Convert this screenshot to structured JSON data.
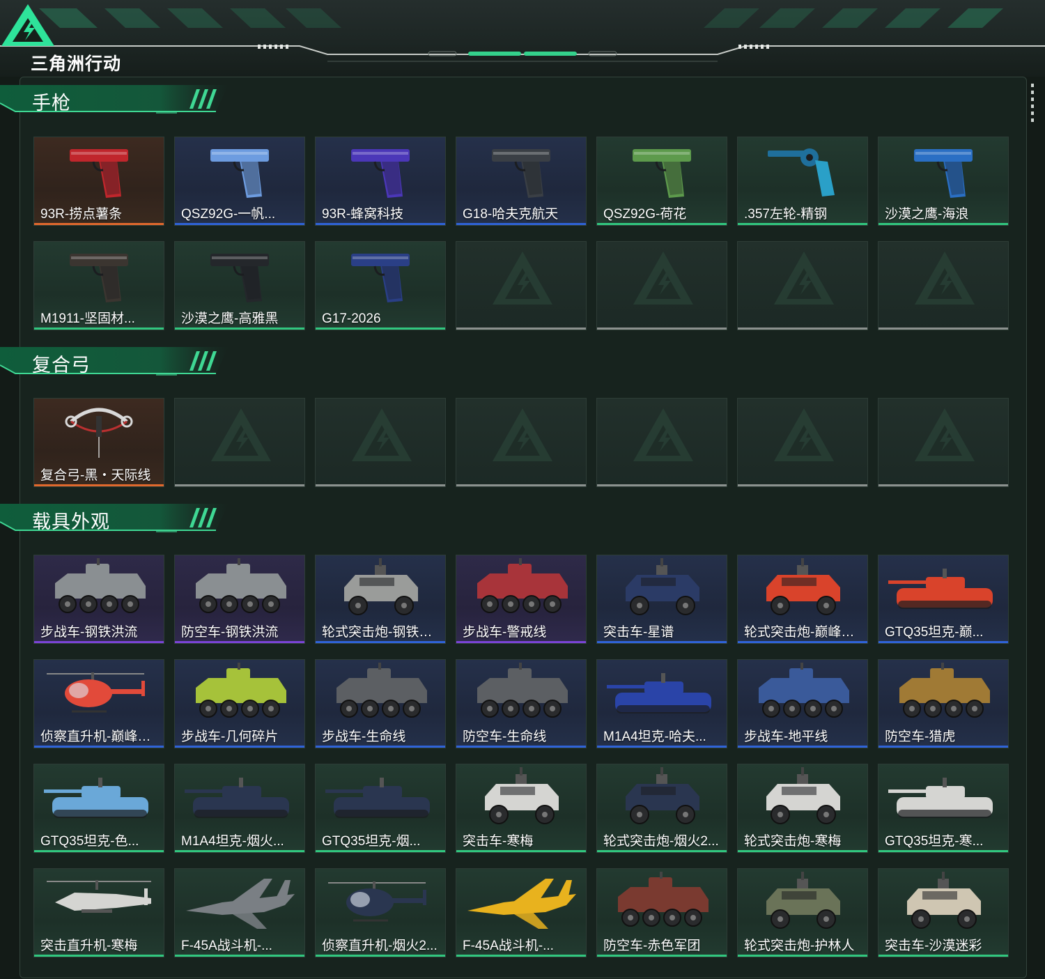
{
  "app": {
    "logo_text": "三角洲行动"
  },
  "colors": {
    "accent": "#31c77f",
    "rarity_orange": "#e1692d",
    "rarity_purple": "#7a44d6",
    "rarity_blue": "#2f63d8",
    "rarity_green": "#31c77f"
  },
  "sections": [
    {
      "title": "手枪",
      "items": [
        {
          "name": "93R-捞点薯条",
          "rarity": "orange",
          "icon": "pistol-icon",
          "color": "#c0262c"
        },
        {
          "name": "QSZ92G-一帆...",
          "rarity": "blue",
          "icon": "pistol-icon",
          "color": "#6d9ce0"
        },
        {
          "name": "93R-蜂窝科技",
          "rarity": "blue",
          "icon": "pistol-icon",
          "color": "#4b37b8"
        },
        {
          "name": "G18-哈夫克航天",
          "rarity": "blue",
          "icon": "pistol-icon",
          "color": "#3a3f45"
        },
        {
          "name": "QSZ92G-荷花",
          "rarity": "green",
          "icon": "pistol-icon",
          "color": "#5d9a4c"
        },
        {
          "name": ".357左轮-精钢",
          "rarity": "green",
          "icon": "revolver-icon",
          "color": "#1f6f9c"
        },
        {
          "name": "沙漠之鹰-海浪",
          "rarity": "green",
          "icon": "pistol-icon",
          "color": "#2a6fc4"
        },
        {
          "name": "M1911-坚固材...",
          "rarity": "green",
          "icon": "pistol-icon",
          "color": "#3b3530"
        },
        {
          "name": "沙漠之鹰-高雅黑",
          "rarity": "green",
          "icon": "pistol-icon",
          "color": "#24272b"
        },
        {
          "name": "G17-2026",
          "rarity": "green",
          "icon": "pistol-icon",
          "color": "#2a3f86"
        },
        {
          "name": "",
          "rarity": "empty"
        },
        {
          "name": "",
          "rarity": "empty"
        },
        {
          "name": "",
          "rarity": "empty"
        },
        {
          "name": "",
          "rarity": "empty"
        }
      ]
    },
    {
      "title": "复合弓",
      "items": [
        {
          "name": "复合弓-黑・天际线",
          "rarity": "orange",
          "icon": "bow-icon",
          "color": "#d9d9d9"
        },
        {
          "name": "",
          "rarity": "empty"
        },
        {
          "name": "",
          "rarity": "empty"
        },
        {
          "name": "",
          "rarity": "empty"
        },
        {
          "name": "",
          "rarity": "empty"
        },
        {
          "name": "",
          "rarity": "empty"
        },
        {
          "name": "",
          "rarity": "empty"
        }
      ]
    },
    {
      "title": "载具外观",
      "items": [
        {
          "name": "步战车-钢铁洪流",
          "rarity": "purple",
          "icon": "apc-icon",
          "color": "#8a8f92"
        },
        {
          "name": "防空车-钢铁洪流",
          "rarity": "purple",
          "icon": "apc-icon",
          "color": "#8a8f92"
        },
        {
          "name": "轮式突击炮-钢铁洪...",
          "rarity": "blue",
          "icon": "armored-car-icon",
          "color": "#9a9c9a"
        },
        {
          "name": "步战车-警戒线",
          "rarity": "purple",
          "icon": "apc-icon",
          "color": "#a8343a"
        },
        {
          "name": "突击车-星谱",
          "rarity": "blue",
          "icon": "armored-car-icon",
          "color": "#2b3b66"
        },
        {
          "name": "轮式突击炮-巅峰竞...",
          "rarity": "blue",
          "icon": "armored-car-icon",
          "color": "#d9432b"
        },
        {
          "name": "GTQ35坦克-巅...",
          "rarity": "blue",
          "icon": "tank-icon",
          "color": "#d9432b"
        },
        {
          "name": "侦察直升机-巅峰竞...",
          "rarity": "blue",
          "icon": "helicopter-icon",
          "color": "#e24a3a"
        },
        {
          "name": "步战车-几何碎片",
          "rarity": "blue",
          "icon": "apc-icon",
          "color": "#a6c23a"
        },
        {
          "name": "步战车-生命线",
          "rarity": "blue",
          "icon": "apc-icon",
          "color": "#5c5f63"
        },
        {
          "name": "防空车-生命线",
          "rarity": "blue",
          "icon": "apc-icon",
          "color": "#5c5f63"
        },
        {
          "name": "M1A4坦克-哈夫...",
          "rarity": "blue",
          "icon": "tank-icon",
          "color": "#2a44a8"
        },
        {
          "name": "步战车-地平线",
          "rarity": "blue",
          "icon": "apc-icon",
          "color": "#3a5a9a"
        },
        {
          "name": "防空车-猎虎",
          "rarity": "blue",
          "icon": "apc-icon",
          "color": "#a07a35"
        },
        {
          "name": "GTQ35坦克-色...",
          "rarity": "green",
          "icon": "tank-icon",
          "color": "#6aa8d8"
        },
        {
          "name": "M1A4坦克-烟火...",
          "rarity": "green",
          "icon": "tank-icon",
          "color": "#2a3650"
        },
        {
          "name": "GTQ35坦克-烟...",
          "rarity": "green",
          "icon": "tank-icon",
          "color": "#2a3650"
        },
        {
          "name": "突击车-寒梅",
          "rarity": "green",
          "icon": "armored-car-icon",
          "color": "#d5d5d2"
        },
        {
          "name": "轮式突击炮-烟火2...",
          "rarity": "green",
          "icon": "armored-car-icon",
          "color": "#2a3650"
        },
        {
          "name": "轮式突击炮-寒梅",
          "rarity": "green",
          "icon": "armored-car-icon",
          "color": "#d5d5d2"
        },
        {
          "name": "GTQ35坦克-寒...",
          "rarity": "green",
          "icon": "tank-icon",
          "color": "#d5d5d2"
        },
        {
          "name": "突击直升机-寒梅",
          "rarity": "green",
          "icon": "attack-helicopter-icon",
          "color": "#d5d5d2"
        },
        {
          "name": "F-45A战斗机-...",
          "rarity": "green",
          "icon": "fighter-jet-icon",
          "color": "#7a7f84"
        },
        {
          "name": "侦察直升机-烟火2...",
          "rarity": "green",
          "icon": "helicopter-icon",
          "color": "#2a3650"
        },
        {
          "name": "F-45A战斗机-...",
          "rarity": "green",
          "icon": "fighter-jet-icon",
          "color": "#e8b21e"
        },
        {
          "name": "防空车-赤色军团",
          "rarity": "green",
          "icon": "apc-icon",
          "color": "#7a3a30"
        },
        {
          "name": "轮式突击炮-护林人",
          "rarity": "green",
          "icon": "armored-car-icon",
          "color": "#6a7358"
        },
        {
          "name": "突击车-沙漠迷彩",
          "rarity": "green",
          "icon": "armored-car-icon",
          "color": "#cfc6b2"
        }
      ]
    }
  ]
}
